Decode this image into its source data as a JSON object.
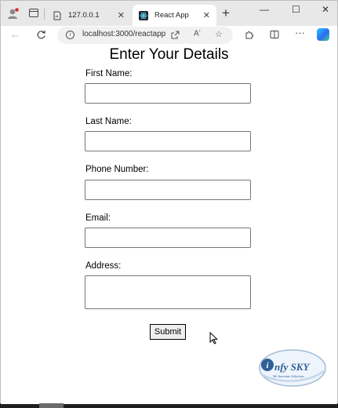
{
  "browser": {
    "tabs": [
      {
        "title": "127.0.0.1",
        "active": false
      },
      {
        "title": "React App",
        "active": true
      }
    ],
    "new_tab_glyph": "+",
    "close_glyph": "✕",
    "window_controls": {
      "minimize": "—",
      "maximize": "☐",
      "close": "✕"
    },
    "url": "localhost:3000/reactapp",
    "icons": [
      "profile-icon",
      "tab-actions-icon",
      "pdf-icon",
      "react-favicon",
      "back-icon",
      "refresh-icon",
      "info-icon",
      "share-icon",
      "read-aloud-icon",
      "favorite-icon",
      "extensions-icon",
      "split-screen-icon",
      "more-icon",
      "copilot-icon"
    ],
    "accent_color": "#0f66d0"
  },
  "form": {
    "title": "Enter Your Details",
    "fields": [
      {
        "label": "First Name:",
        "value": ""
      },
      {
        "label": "Last Name:",
        "value": ""
      },
      {
        "label": "Phone Number:",
        "value": ""
      },
      {
        "label": "Email:",
        "value": ""
      },
      {
        "label": "Address:",
        "value": ""
      }
    ],
    "submit_label": "Submit"
  },
  "watermark": {
    "brand": "nfy SKY",
    "tagline": "We Innovate Solutions"
  }
}
